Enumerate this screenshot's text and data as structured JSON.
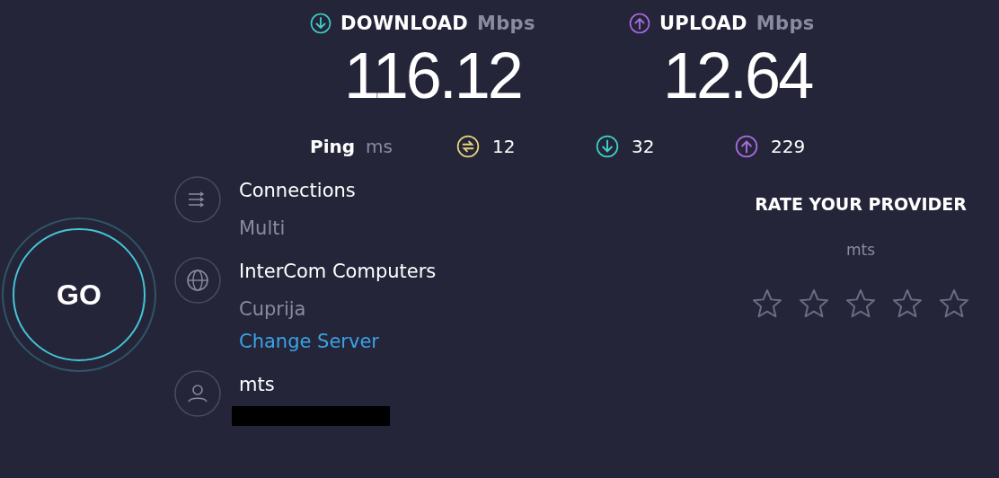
{
  "speeds": [
    {
      "kind": "download",
      "label": "DOWNLOAD",
      "unit": "Mbps",
      "value": "116.12"
    },
    {
      "kind": "upload",
      "label": "UPLOAD",
      "unit": "Mbps",
      "value": "12.64"
    }
  ],
  "ping": {
    "label": "Ping",
    "unit": "ms",
    "readings": [
      {
        "kind": "idle",
        "value": "12"
      },
      {
        "kind": "download",
        "value": "32"
      },
      {
        "kind": "upload",
        "value": "229"
      }
    ]
  },
  "go_button": {
    "label": "GO"
  },
  "details": [
    {
      "kind": "connections",
      "title": "Connections",
      "subtitle": "Multi"
    },
    {
      "kind": "server",
      "title": "InterCom Computers",
      "subtitle": "Cuprija",
      "link": "Change Server"
    },
    {
      "kind": "provider",
      "title": "mts",
      "redacted": true
    }
  ],
  "rating": {
    "title": "RATE YOUR PROVIDER",
    "provider": "mts",
    "stars": 0
  }
}
